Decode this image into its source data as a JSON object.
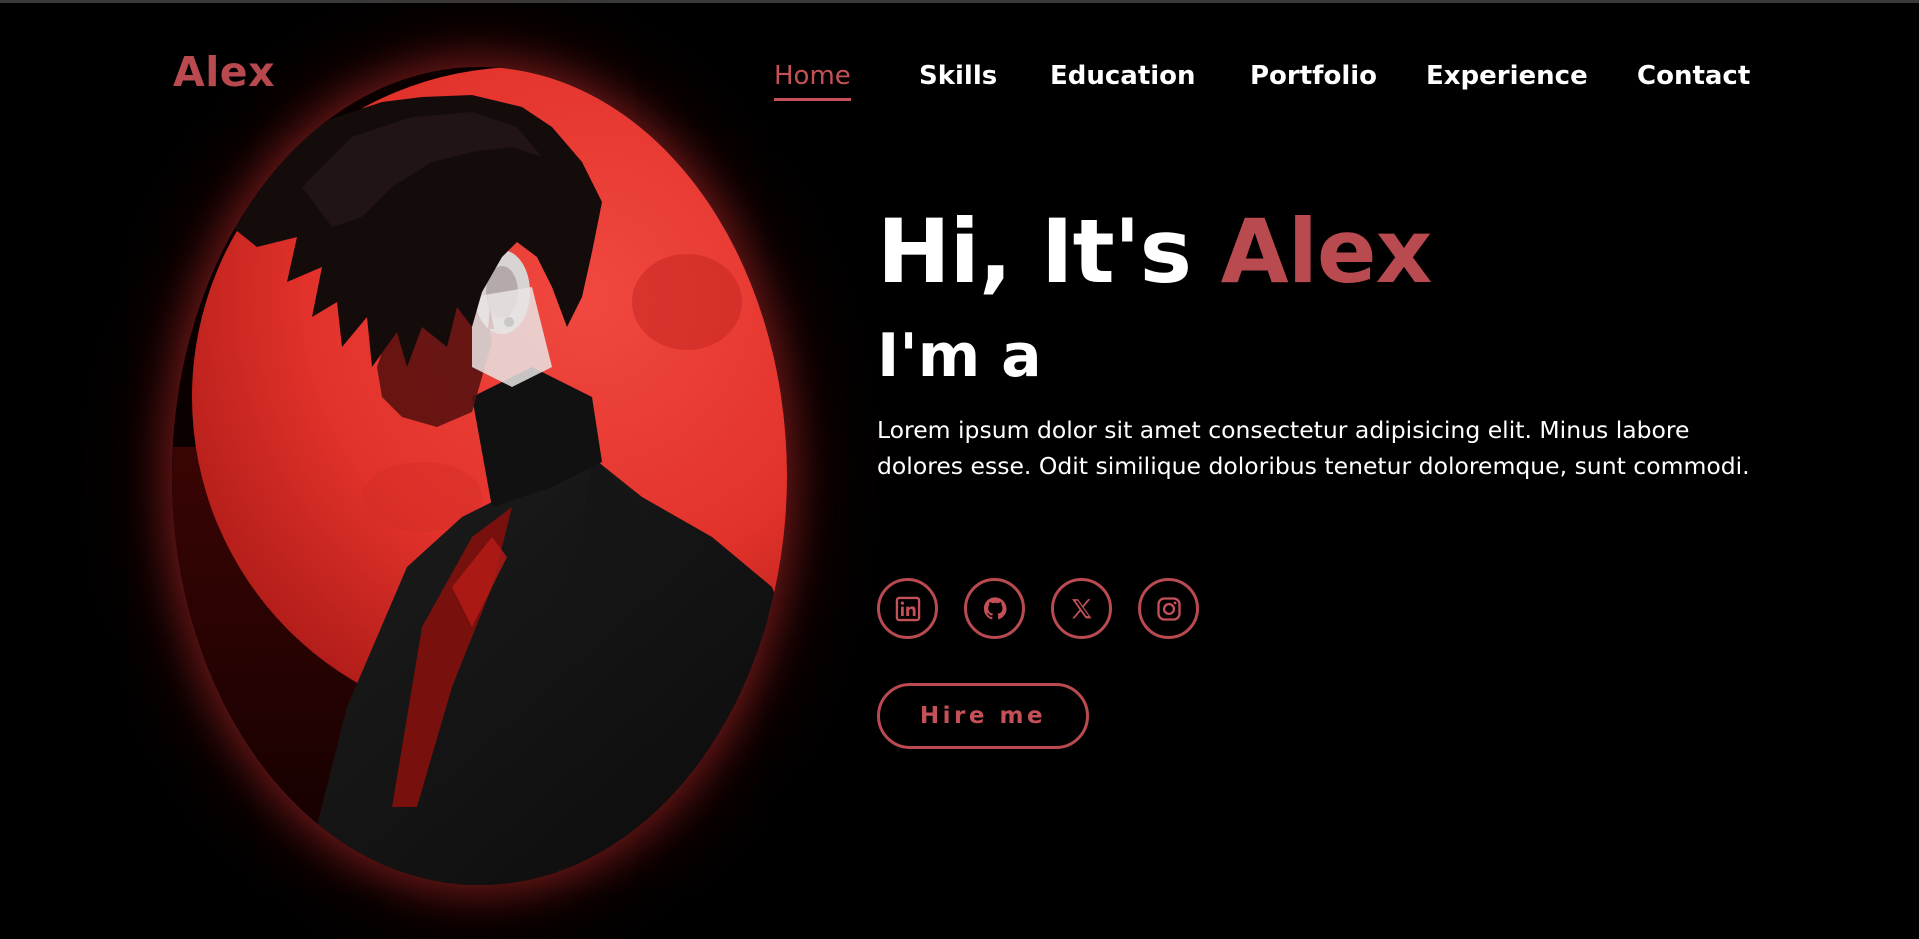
{
  "header": {
    "logo": "Alex",
    "nav": [
      {
        "label": "Home",
        "active": true
      },
      {
        "label": "Skills",
        "active": false
      },
      {
        "label": "Education",
        "active": false
      },
      {
        "label": "Portfolio",
        "active": false
      },
      {
        "label": "Experience",
        "active": false
      },
      {
        "label": "Contact",
        "active": false
      }
    ]
  },
  "hero": {
    "greeting": "Hi, It's",
    "name": "Alex",
    "subtitle": "I'm a",
    "description": "Lorem ipsum dolor sit amet consectetur adipisicing elit. Minus labore dolores esse. Odit similique doloribus tenetur doloremque, sunt commodi.",
    "hire_label": "Hire me"
  },
  "socials": [
    {
      "icon": "linkedin-icon"
    },
    {
      "icon": "github-icon"
    },
    {
      "icon": "x-twitter-icon"
    },
    {
      "icon": "instagram-icon"
    }
  ],
  "colors": {
    "accent": "#b84a50",
    "background": "#000000",
    "text": "#ffffff",
    "moon": "#e8302b"
  }
}
